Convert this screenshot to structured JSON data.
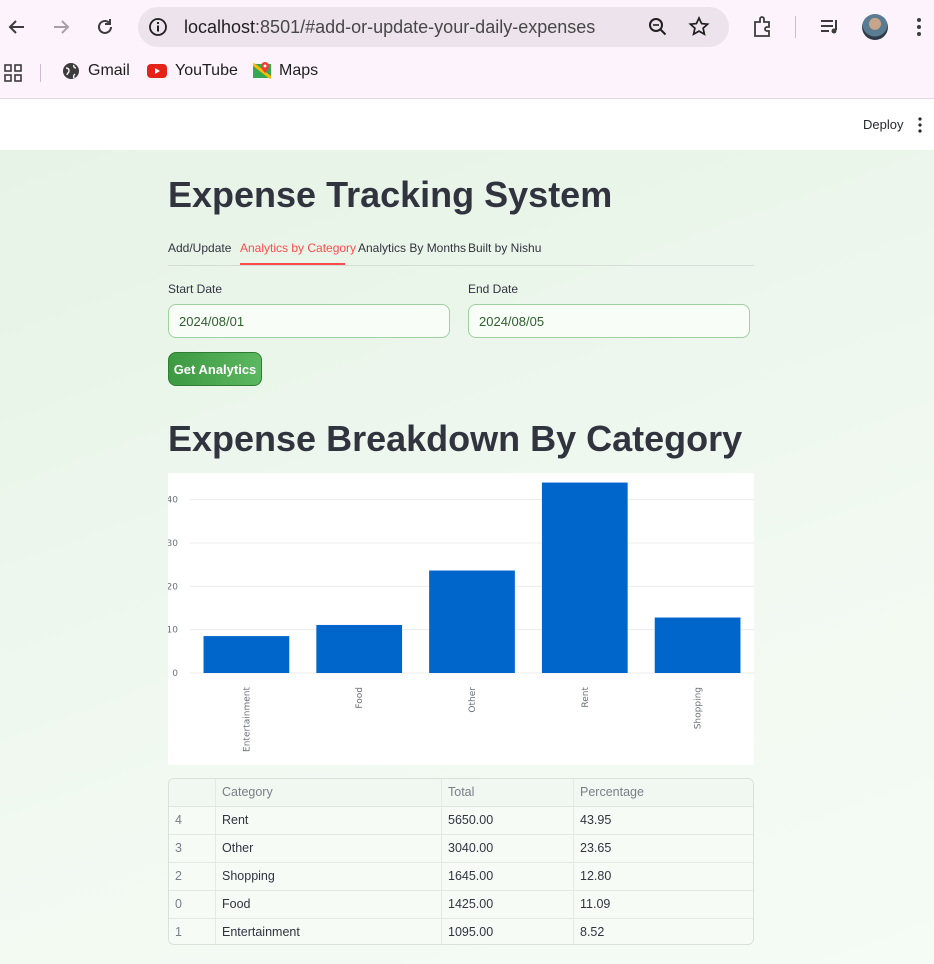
{
  "browser": {
    "url_host": "localhost",
    "url_rest": ":8501/#add-or-update-your-daily-expenses",
    "bookmarks": [
      {
        "label": "Gmail",
        "icon": "globe-icon"
      },
      {
        "label": "YouTube",
        "icon": "youtube-icon"
      },
      {
        "label": "Maps",
        "icon": "maps-icon"
      }
    ]
  },
  "streamlit": {
    "deploy_label": "Deploy"
  },
  "app": {
    "title": "Expense Tracking System",
    "tabs": [
      {
        "label": "Add/Update",
        "active": false
      },
      {
        "label": "Analytics by Category",
        "active": true
      },
      {
        "label": "Analytics By Months",
        "active": false
      },
      {
        "label": "Built by Nishu",
        "active": false
      }
    ],
    "start_date": {
      "label": "Start Date",
      "value": "2024/08/01"
    },
    "end_date": {
      "label": "End Date",
      "value": "2024/08/05"
    },
    "button_label": "Get Analytics",
    "section_title": "Expense Breakdown By Category"
  },
  "colors": {
    "bar": "#0066cc",
    "accent": "#ff4b4b",
    "button": "#4caf50"
  },
  "chart_data": {
    "type": "bar",
    "categories": [
      "Entertainment",
      "Food",
      "Other",
      "Rent",
      "Shopping"
    ],
    "values": [
      8.52,
      11.09,
      23.65,
      43.95,
      12.8
    ],
    "yticks": [
      0,
      10,
      20,
      30,
      40
    ],
    "ylim": [
      0,
      45
    ],
    "grid": true
  },
  "table": {
    "columns": [
      "",
      "Category",
      "Total",
      "Percentage"
    ],
    "rows": [
      [
        "4",
        "Rent",
        "5650.00",
        "43.95"
      ],
      [
        "3",
        "Other",
        "3040.00",
        "23.65"
      ],
      [
        "2",
        "Shopping",
        "1645.00",
        "12.80"
      ],
      [
        "0",
        "Food",
        "1425.00",
        "11.09"
      ],
      [
        "1",
        "Entertainment",
        "1095.00",
        "8.52"
      ]
    ]
  }
}
